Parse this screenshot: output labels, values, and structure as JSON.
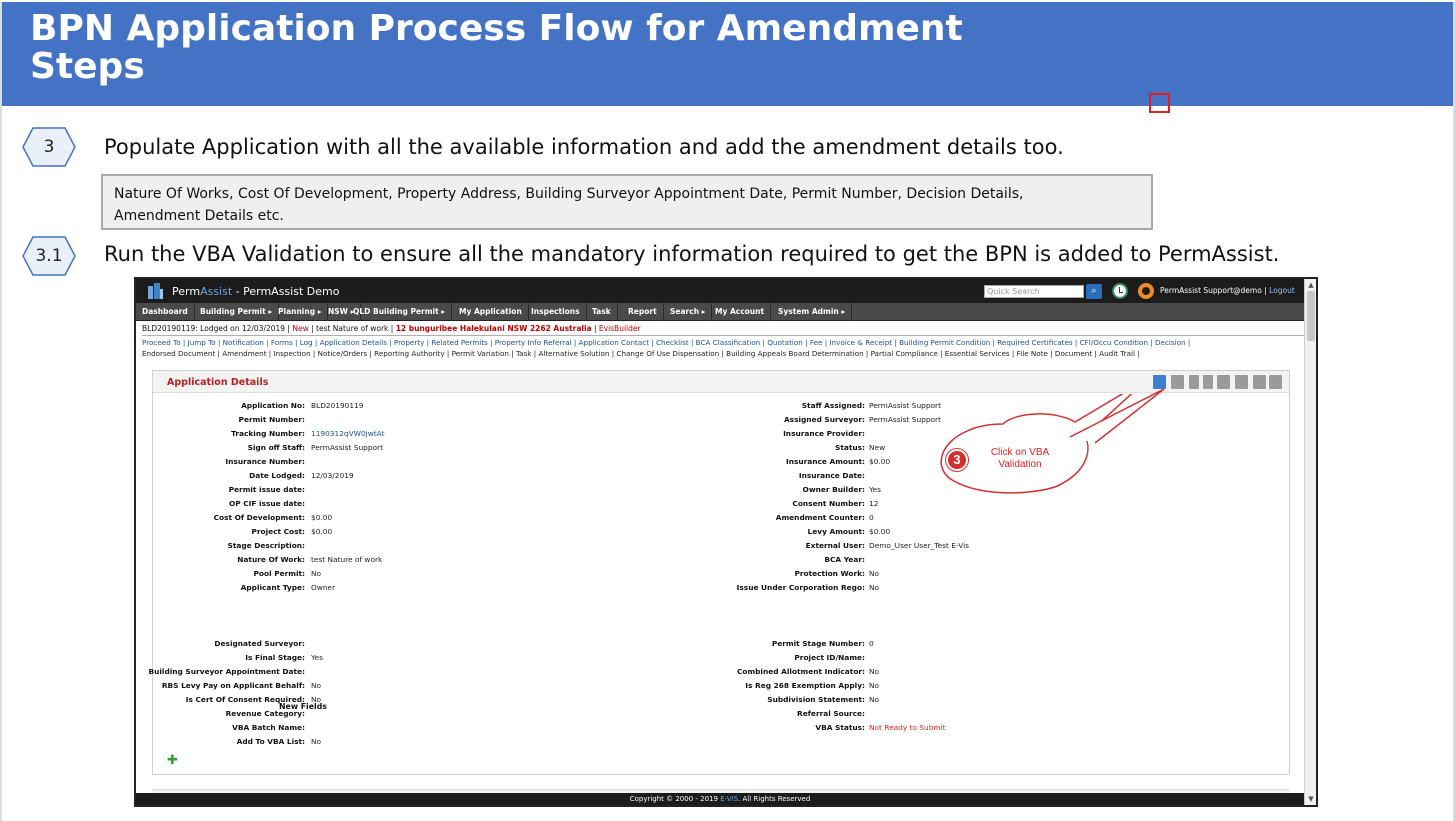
{
  "slide": {
    "title_line1": "BPN Application Process Flow for Amendment",
    "title_line2": "Steps"
  },
  "steps": [
    {
      "number": "3",
      "text": "Populate Application with all the available information and add the amendment details too."
    },
    {
      "number": "3.1",
      "text": "Run the VBA Validation to ensure all the mandatory information required to get the BPN is added to PermAssist."
    }
  ],
  "note": {
    "line1": "Nature Of Works, Cost Of Development, Property Address, Building Surveyor Appointment Date, Permit Number, Decision Details,",
    "line2": "Amendment Details etc."
  },
  "app": {
    "brand_a": "Perm",
    "brand_b": "Assist",
    "brand_rest": " - PermAssist Demo",
    "quick_search_placeholder": "Quick Search",
    "user": "PermAssist Support@demo",
    "sep": " | ",
    "logout": "Logout",
    "menu": [
      "Dashboard",
      "Building Permit ▸",
      "Planning ▸",
      "NSW ▸",
      "QLD Building Permit ▸",
      "My Application",
      "Inspections",
      "Task",
      "Report",
      "Search ▸",
      "My Account",
      "System Admin ▸"
    ],
    "crumb": {
      "prefix": "BLD20190119: Lodged on 12/03/2019 | ",
      "status": "New",
      "mid": " | test Nature of work | ",
      "address": "12 bunguribee Halekulani NSW 2262 Australia",
      "sep": " | ",
      "builder": "EvisBuilder"
    },
    "links_line1": "Proceed To  |  Jump To  |  Notification  |  Forms  |  Log  |  Application Details  |  Property  |  Related Permits  |  Property Info Referral  |  Application Contact  |  Checklist  |  BCA Classification  |  Quotation  |  Fee  |  Invoice & Receipt  |  Building Permit Condition  |  Required Certificates  |  CFI/Occu Condition  |  Decision  |",
    "links_line2": "Endorsed Document  |  Amendment  |  Inspection  |  Notice/Orders  |  Reporting Authority  |  Permit Variation  |  Task  |  Alternative Solution  |  Change Of Use Dispensation  |  Building Appeals Board Determination  |  Partial Compliance  |  Essential Services  |  File Note  |  Document  |  Audit Trail  |",
    "panel_title": "Application Details",
    "left_fields": [
      {
        "label": "Application No:",
        "value": "BLD20190119"
      },
      {
        "label": "Permit Number:",
        "value": ""
      },
      {
        "label": "Tracking Number:",
        "value": "1190312qVW0jwtAt"
      },
      {
        "label": "Sign off Staff:",
        "value": "PermAssist Support"
      },
      {
        "label": "Insurance Number:",
        "value": ""
      },
      {
        "label": "Date Lodged:",
        "value": "12/03/2019"
      },
      {
        "label": "Permit issue date:",
        "value": ""
      },
      {
        "label": "OP CIF issue date:",
        "value": ""
      },
      {
        "label": "Cost Of Development:",
        "value": "$0.00"
      },
      {
        "label": "Project Cost:",
        "value": "$0.00"
      },
      {
        "label": "Stage Description:",
        "value": ""
      },
      {
        "label": "Nature Of Work:",
        "value": "test Nature of work"
      },
      {
        "label": "Pool Permit:",
        "value": "No"
      },
      {
        "label": "Applicant Type:",
        "value": "Owner"
      }
    ],
    "right_fields": [
      {
        "label": "Staff Assigned:",
        "value": "PermAssist Support"
      },
      {
        "label": "Assigned Surveyor:",
        "value": "PermAssist Support"
      },
      {
        "label": "Insurance Provider:",
        "value": ""
      },
      {
        "label": "Status:",
        "value": "New"
      },
      {
        "label": "Insurance Amount:",
        "value": "$0.00"
      },
      {
        "label": "Insurance Date:",
        "value": ""
      },
      {
        "label": "Owner Builder:",
        "value": "Yes"
      },
      {
        "label": "Consent Number:",
        "value": "12"
      },
      {
        "label": "Amendment Counter:",
        "value": "0"
      },
      {
        "label": "Levy Amount:",
        "value": "$0.00"
      },
      {
        "label": "External User:",
        "value": "Demo_User User_Test E-Vis"
      },
      {
        "label": "BCA Year:",
        "value": ""
      },
      {
        "label": "Protection Work:",
        "value": "No"
      },
      {
        "label": "Issue Under Corporation Rego:",
        "value": "No"
      }
    ],
    "new_fields_title": "New Fields",
    "left_new": [
      {
        "label": "Designated Surveyor:",
        "value": ""
      },
      {
        "label": "Is Final Stage:",
        "value": "Yes"
      },
      {
        "label": "Building Surveyor Appointment Date:",
        "value": ""
      },
      {
        "label": "RBS Levy Pay on Applicant Behalf:",
        "value": "No"
      },
      {
        "label": "Is Cert Of Consent Required:",
        "value": "No"
      },
      {
        "label": "Revenue Category:",
        "value": ""
      },
      {
        "label": "VBA Batch Name:",
        "value": ""
      },
      {
        "label": "Add To VBA List:",
        "value": "No"
      }
    ],
    "right_new": [
      {
        "label": "Permit Stage Number:",
        "value": "0"
      },
      {
        "label": "Project ID/Name:",
        "value": ""
      },
      {
        "label": "Combined Allotment Indicator:",
        "value": "No"
      },
      {
        "label": "Is Reg 268 Exemption Apply:",
        "value": "No"
      },
      {
        "label": "Subdivision Statement:",
        "value": "No"
      },
      {
        "label": "Referral Source:",
        "value": ""
      },
      {
        "label": "VBA Status:",
        "value": "Not Ready to Submit"
      }
    ],
    "footer_a": "Copyright © 2000 - 2019 ",
    "footer_b": "E-VIS",
    "footer_c": ". All Rights Reserved"
  },
  "callout": {
    "badge": "3",
    "text": "Click on VBA Validation"
  },
  "colors": {
    "header_blue": "#4472c4",
    "accent_red": "#e02020"
  }
}
